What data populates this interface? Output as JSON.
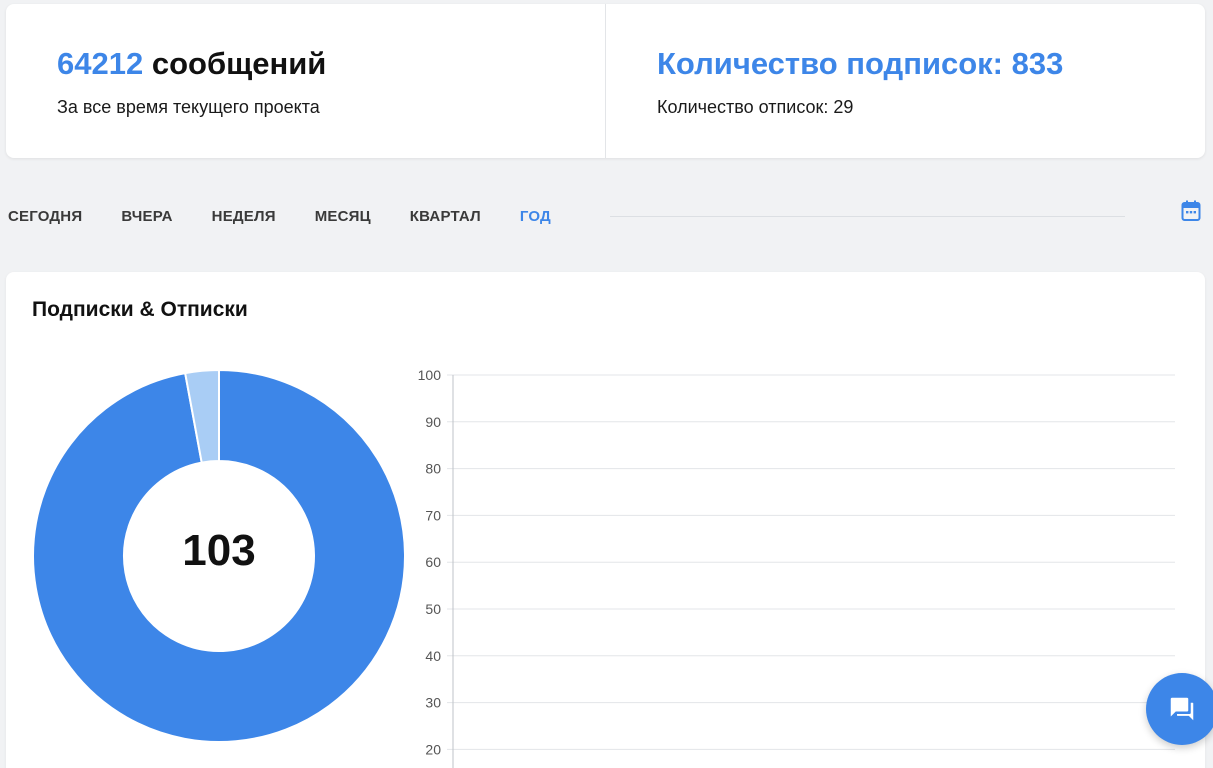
{
  "stats": {
    "messages": {
      "count": "64212",
      "label": " сообщений",
      "subtitle": "За все время текущего проекта"
    },
    "subscriptions": {
      "title": "Количество подписок: 833",
      "subtitle": "Количество отписок: 29"
    }
  },
  "periods": {
    "tabs": [
      "СЕГОДНЯ",
      "ВЧЕРА",
      "НЕДЕЛЯ",
      "МЕСЯЦ",
      "КВАРТАЛ",
      "ГОД"
    ],
    "active": "ГОД"
  },
  "icons": {
    "calendar": "calendar-icon",
    "chat": "chat-icon"
  },
  "colors": {
    "accent": "#3d86e8",
    "accent_light": "#a9cdf5",
    "grid": "#e3e5e8"
  },
  "chart_section": {
    "title": "Подписки & Отписки"
  },
  "chart_data": [
    {
      "type": "pie",
      "center_label": "103",
      "values": [
        100,
        3
      ],
      "colors": [
        "#3d86e8",
        "#a9cdf5"
      ]
    },
    {
      "type": "line",
      "ylim": [
        20,
        100
      ],
      "y_ticks": [
        100,
        90,
        80,
        70,
        60,
        50,
        40,
        30,
        20
      ],
      "series": []
    }
  ]
}
